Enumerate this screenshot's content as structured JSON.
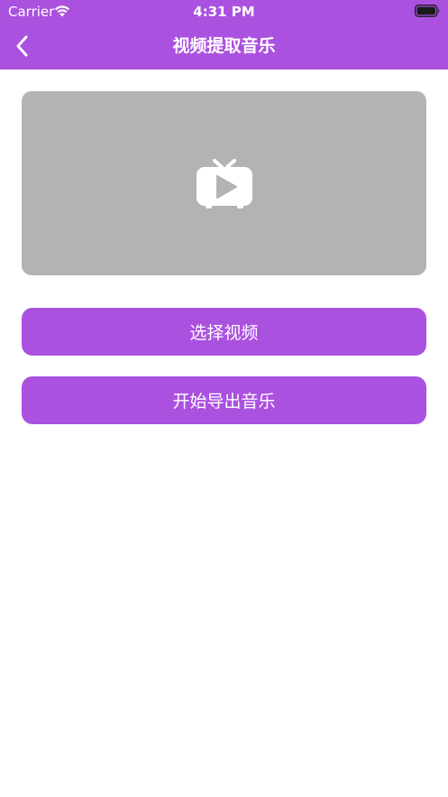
{
  "status_bar": {
    "carrier": "Carrier",
    "time": "4:31 PM"
  },
  "nav": {
    "title": "视频提取音乐",
    "back_icon": "chevron-left-icon"
  },
  "preview": {
    "icon": "tv-play-icon"
  },
  "buttons": {
    "select_video": "选择视频",
    "start_export": "开始导出音乐"
  },
  "colors": {
    "accent": "#ab51e0",
    "preview_bg": "#b3b3b3",
    "background": "#ffffff"
  }
}
